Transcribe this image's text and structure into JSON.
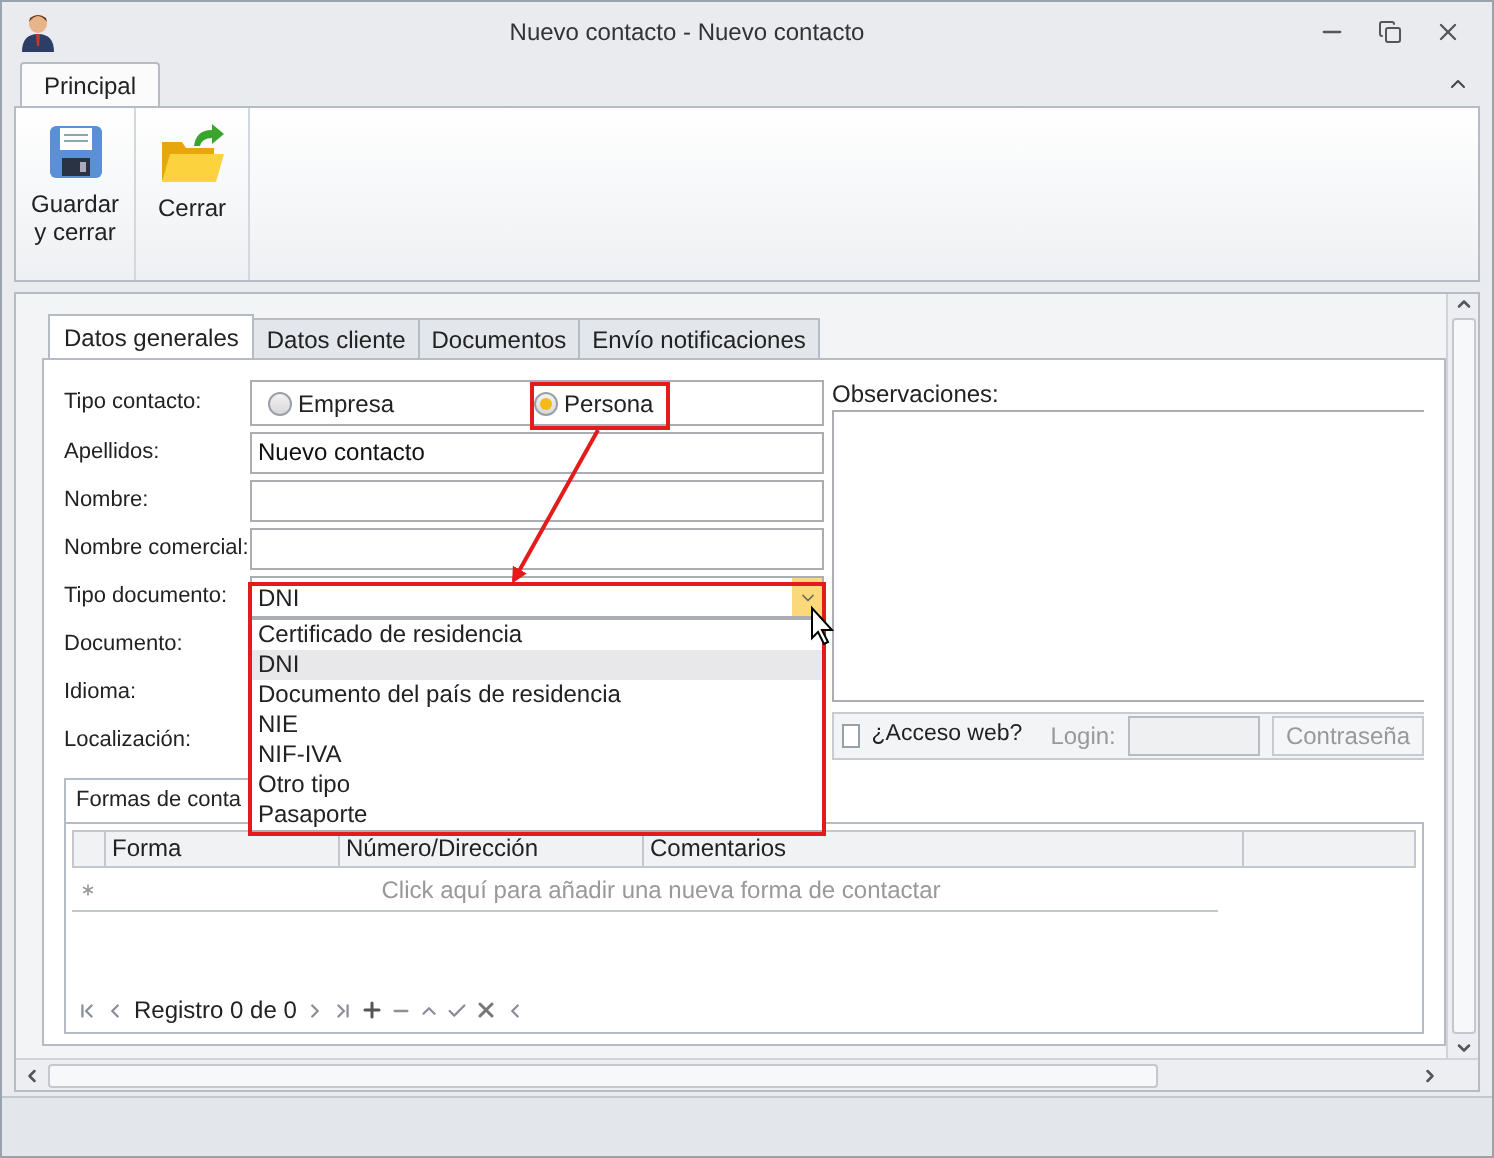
{
  "window": {
    "title": "Nuevo contacto - Nuevo contacto"
  },
  "ribbon": {
    "tabs": [
      {
        "label": "Principal",
        "selected": true
      }
    ],
    "buttons": [
      {
        "label": "Guardar y cerrar",
        "kind": "save"
      },
      {
        "label": "Cerrar",
        "kind": "close"
      }
    ]
  },
  "tabs": [
    {
      "label": "Datos generales",
      "selected": true
    },
    {
      "label": "Datos cliente",
      "selected": false
    },
    {
      "label": "Documentos",
      "selected": false
    },
    {
      "label": "Envío notificaciones",
      "selected": false
    }
  ],
  "form": {
    "tipo_contacto": {
      "label": "Tipo contacto:",
      "options": [
        {
          "label": "Empresa",
          "selected": false
        },
        {
          "label": "Persona",
          "selected": true
        }
      ]
    },
    "fields": [
      {
        "label": "Apellidos:",
        "value": "Nuevo contacto"
      },
      {
        "label": "Nombre:"
      },
      {
        "label": "Nombre comercial:"
      }
    ],
    "tipo_documento": {
      "label": "Tipo documento:",
      "value": "DNI",
      "expanded": true,
      "options": [
        {
          "label": "Certificado de residencia",
          "selected": false
        },
        {
          "label": "DNI",
          "selected": true
        },
        {
          "label": "Documento del país de residencia",
          "selected": false
        },
        {
          "label": "NIE",
          "selected": false
        },
        {
          "label": "NIF-IVA",
          "selected": false
        },
        {
          "label": "Otro tipo",
          "selected": false
        },
        {
          "label": "Pasaporte",
          "selected": false
        }
      ]
    },
    "more_labels": [
      "Documento:",
      "Idioma:",
      "Localización:"
    ]
  },
  "observaciones": {
    "label": "Observaciones:"
  },
  "web_access": {
    "label": "¿Acceso web?",
    "checked": false,
    "login_label": "Login:",
    "password_button": "Contraseña"
  },
  "contact_forms": {
    "title": "Formas de conta",
    "columns": [
      "Forma",
      "Número/Dirección",
      "Comentarios"
    ],
    "new_row_hint": "Click aquí para añadir una nueva forma de contactar",
    "navigator": "Registro 0 de 0"
  }
}
